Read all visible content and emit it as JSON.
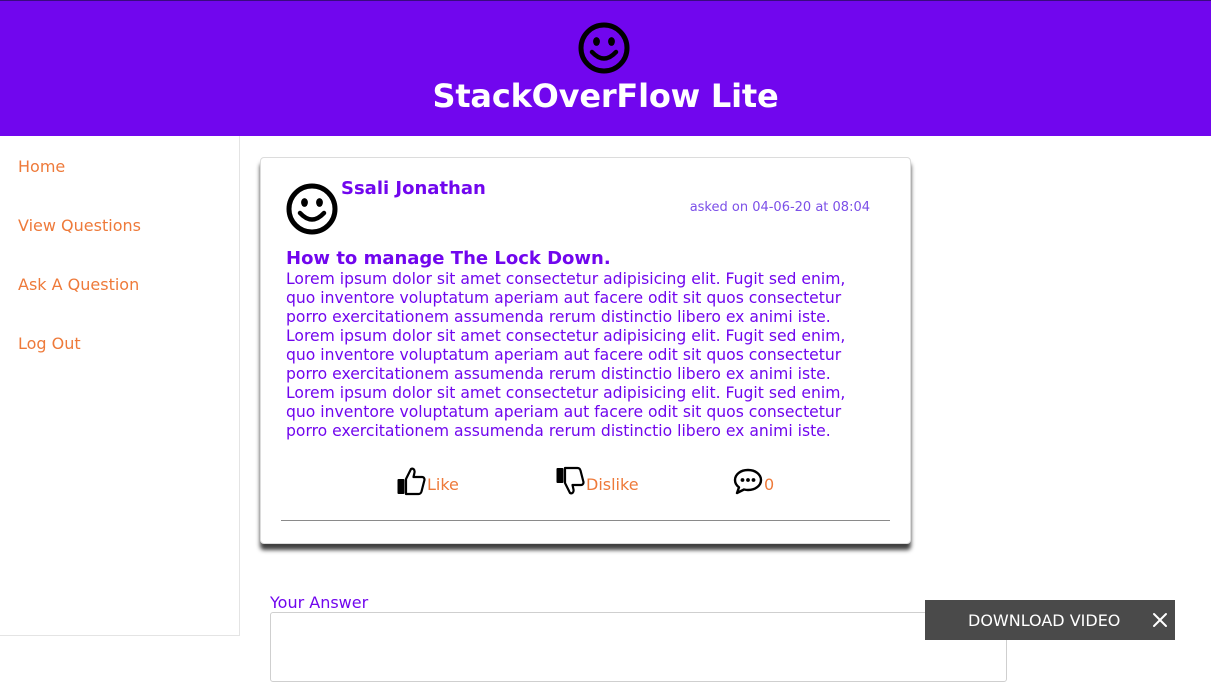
{
  "header": {
    "title": "StackOverFlow Lite",
    "logo_icon": "smiley-icon"
  },
  "sidebar": {
    "items": [
      {
        "label": "Home"
      },
      {
        "label": "View Questions"
      },
      {
        "label": "Ask A Question"
      },
      {
        "label": "Log Out"
      }
    ]
  },
  "question": {
    "author": "Ssali Jonathan",
    "asked": "asked on 04-06-20 at 08:04",
    "title": "How to manage The Lock Down.",
    "body": "Lorem ipsum dolor sit amet consectetur adipisicing elit. Fugit sed enim, quo inventore voluptatum aperiam aut facere odit sit quos consectetur porro exercitationem assumenda rerum distinctio libero ex animi iste. Lorem ipsum dolor sit amet consectetur adipisicing elit. Fugit sed enim, quo inventore voluptatum aperiam aut facere odit sit quos consectetur porro exercitationem assumenda rerum distinctio libero ex animi iste. Lorem ipsum dolor sit amet consectetur adipisicing elit. Fugit sed enim, quo inventore voluptatum aperiam aut facere odit sit quos consectetur porro exercitationem assumenda rerum distinctio libero ex animi iste.",
    "like_label": "Like",
    "dislike_label": "Dislike",
    "comment_count": "0"
  },
  "answer": {
    "label": "Your Answer",
    "value": ""
  },
  "download_bar": {
    "label": "DOWNLOAD VIDEO"
  },
  "colors": {
    "brand": "#7106ee",
    "accent": "#ee7a3a"
  }
}
